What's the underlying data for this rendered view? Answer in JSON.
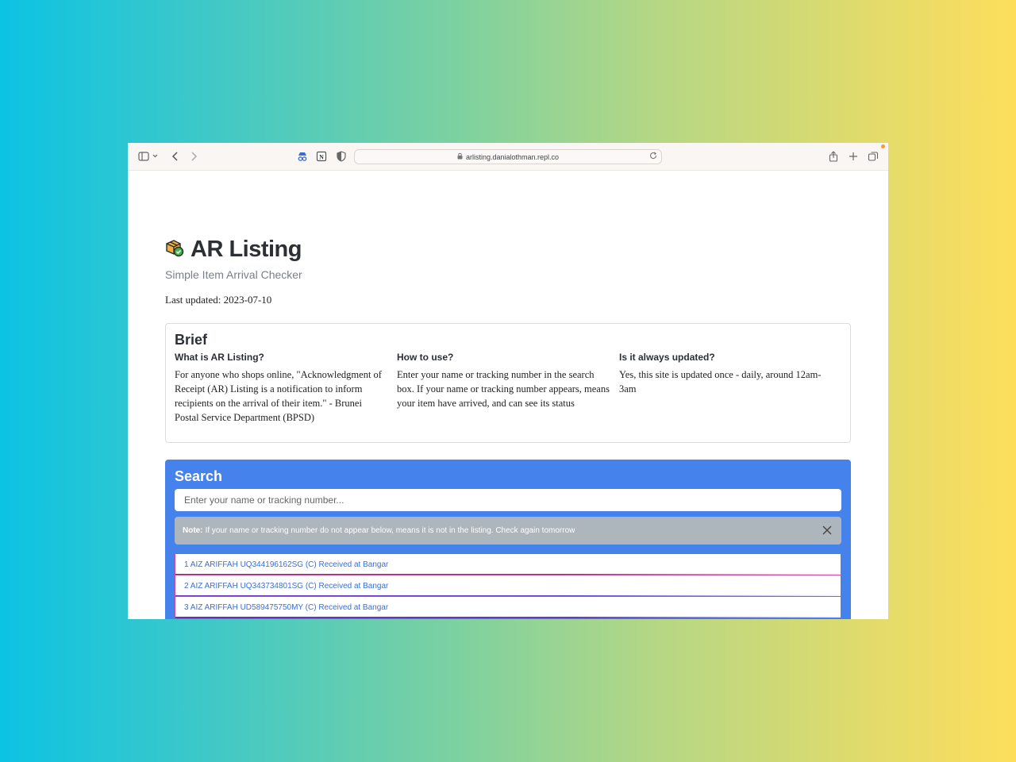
{
  "browser": {
    "url": "arlisting.danialothman.repl.co"
  },
  "page": {
    "title": "AR Listing",
    "subtitle": "Simple Item Arrival Checker",
    "last_updated": "Last updated: 2023-07-10"
  },
  "brief": {
    "heading": "Brief",
    "columns": [
      {
        "heading": "What is AR Listing?",
        "text": "For anyone who shops online, \"Acknowledgment of Receipt (AR) Listing is a notification to inform recipients on the arrival of their item.\" - Brunei Postal Service Department (BPSD)"
      },
      {
        "heading": "How to use?",
        "text": "Enter your name or tracking number in the search box. If your name or tracking number appears, means your item have arrived, and can see its status"
      },
      {
        "heading": "Is it always updated?",
        "text": "Yes, this site is updated once - daily, around 12am-3am"
      }
    ]
  },
  "search": {
    "heading": "Search",
    "placeholder": "Enter your name or tracking number...",
    "note_label": "Note:",
    "note_text": "If your name or tracking number do not appear below, means it is not in the listing. Check again tomorrow",
    "results": [
      "1 AIZ ARIFFAH UQ344196162SG (C) Received at Bangar",
      "2 AIZ ARIFFAH UQ343734801SG (C) Received at Bangar",
      "3 AIZ ARIFFAH UD589475750MY (C) Received at Bangar"
    ]
  },
  "colors": {
    "search_bg": "#4582ec",
    "note_bg": "#adb5bd",
    "link": "#3a6fd8"
  }
}
